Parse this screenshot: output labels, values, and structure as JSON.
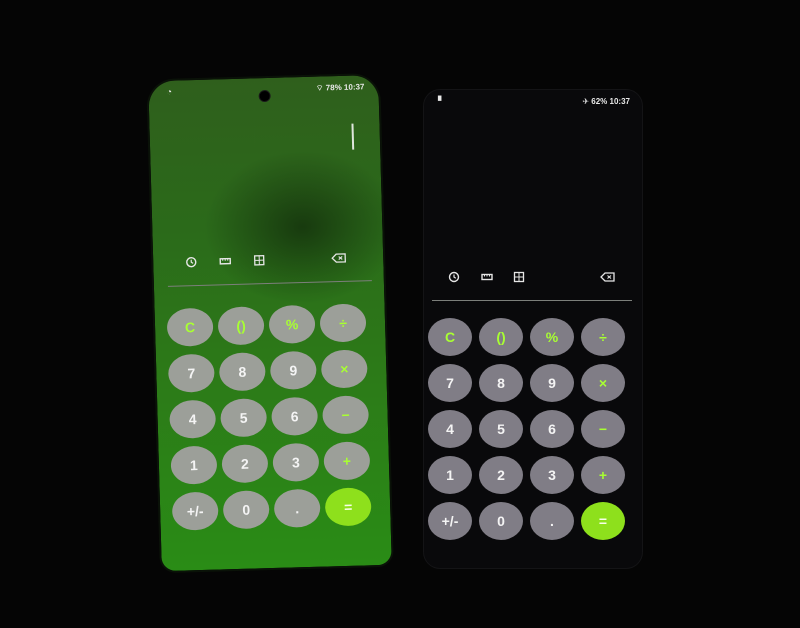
{
  "colors": {
    "accent": "#a8ff32",
    "equals_bg": "#8ee01c"
  },
  "phones": [
    {
      "id": "left",
      "status": {
        "left_icon": "whatsapp-icon",
        "battery": "78%",
        "time": "10:37"
      },
      "toolbar_icons": [
        "history-icon",
        "ruler-icon",
        "scientific-icon",
        "backspace-icon"
      ]
    },
    {
      "id": "right",
      "status": {
        "left_icon": "notification-icon",
        "battery": "62%",
        "time": "10:37"
      },
      "toolbar_icons": [
        "history-icon",
        "ruler-icon",
        "scientific-icon",
        "backspace-icon"
      ]
    }
  ],
  "keys": [
    [
      {
        "label": "C",
        "type": "op"
      },
      {
        "label": "()",
        "type": "op"
      },
      {
        "label": "%",
        "type": "op"
      },
      {
        "label": "÷",
        "type": "op"
      }
    ],
    [
      {
        "label": "7",
        "type": "num"
      },
      {
        "label": "8",
        "type": "num"
      },
      {
        "label": "9",
        "type": "num"
      },
      {
        "label": "×",
        "type": "op"
      }
    ],
    [
      {
        "label": "4",
        "type": "num"
      },
      {
        "label": "5",
        "type": "num"
      },
      {
        "label": "6",
        "type": "num"
      },
      {
        "label": "−",
        "type": "op"
      }
    ],
    [
      {
        "label": "1",
        "type": "num"
      },
      {
        "label": "2",
        "type": "num"
      },
      {
        "label": "3",
        "type": "num"
      },
      {
        "label": "+",
        "type": "op"
      }
    ],
    [
      {
        "label": "+/-",
        "type": "num"
      },
      {
        "label": "0",
        "type": "num"
      },
      {
        "label": ".",
        "type": "num"
      },
      {
        "label": "=",
        "type": "eq"
      }
    ]
  ]
}
